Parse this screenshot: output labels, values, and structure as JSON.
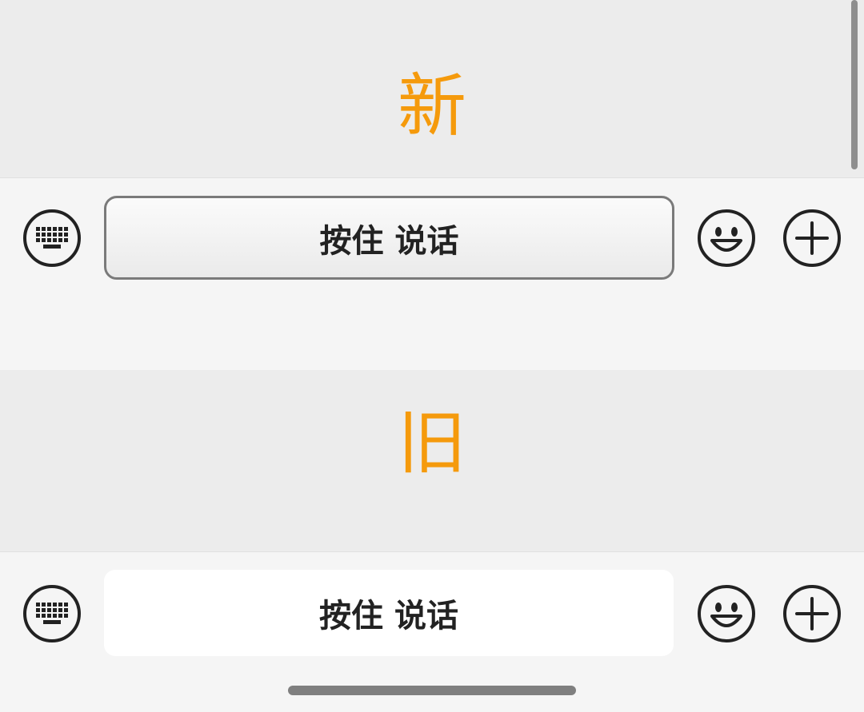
{
  "colors": {
    "label_accent": "#f59a0c",
    "icon_stroke": "#222222"
  },
  "new_section": {
    "label": "新",
    "toolbar": {
      "left_icon": "keyboard-icon",
      "talk_button_label": "按住 说话",
      "emoji_icon": "emoji-icon",
      "plus_icon": "plus-icon"
    }
  },
  "old_section": {
    "label": "旧",
    "toolbar": {
      "left_icon": "keyboard-icon",
      "talk_button_label": "按住 说话",
      "emoji_icon": "emoji-icon",
      "plus_icon": "plus-icon"
    }
  }
}
